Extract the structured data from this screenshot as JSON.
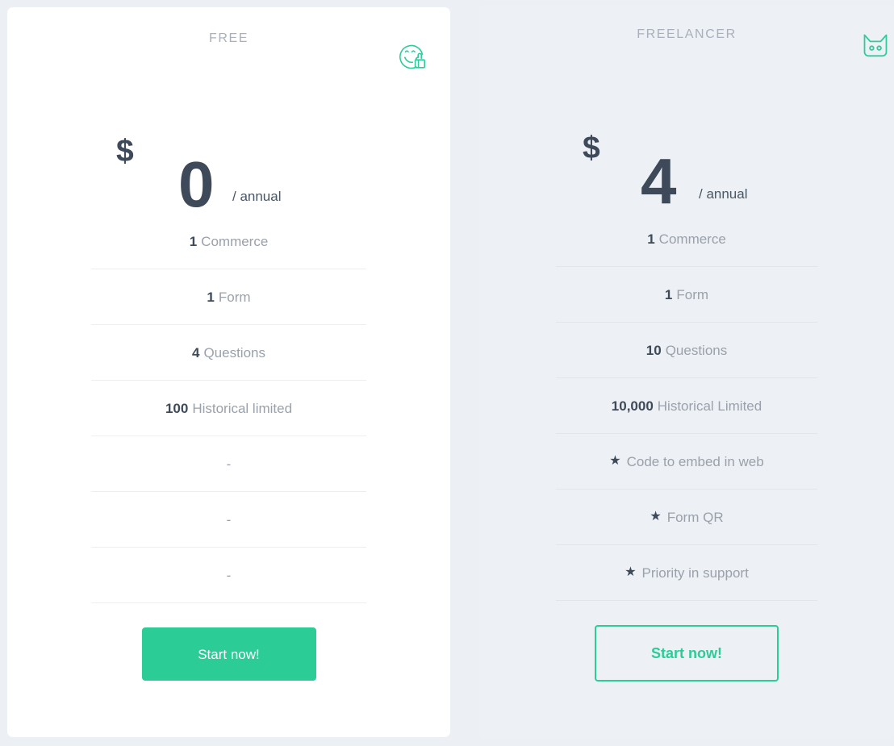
{
  "theme": {
    "page_background": "#eceff4",
    "accent": "#2bcc96",
    "value_text": "#3e4a59",
    "label_text": "#9aa1ab",
    "plan_name_text": "#a9b0bb"
  },
  "plans": [
    {
      "name": "FREE",
      "icon": "smiley-thumbs-up-icon",
      "currency": "$",
      "amount": "0",
      "period": "/ annual",
      "card_background": "#ffffff",
      "features": [
        {
          "value": "1",
          "label": "Commerce",
          "star": false,
          "empty": false
        },
        {
          "value": "1",
          "label": "Form",
          "star": false,
          "empty": false
        },
        {
          "value": "4",
          "label": "Questions",
          "star": false,
          "empty": false
        },
        {
          "value": "100",
          "label": "Historical limited",
          "star": false,
          "empty": false
        },
        {
          "value": "",
          "label": "-",
          "star": false,
          "empty": true
        },
        {
          "value": "",
          "label": "-",
          "star": false,
          "empty": true
        },
        {
          "value": "",
          "label": "-",
          "star": false,
          "empty": true
        }
      ],
      "cta_label": "Start now!",
      "cta_style": "solid"
    },
    {
      "name": "FREELANCER",
      "icon": "cat-mask-icon",
      "currency": "$",
      "amount": "4",
      "period": "/ annual",
      "card_background": "#edf0f5",
      "features": [
        {
          "value": "1",
          "label": "Commerce",
          "star": false,
          "empty": false
        },
        {
          "value": "1",
          "label": "Form",
          "star": false,
          "empty": false
        },
        {
          "value": "10",
          "label": "Questions",
          "star": false,
          "empty": false
        },
        {
          "value": "10,000",
          "label": "Historical Limited",
          "star": false,
          "empty": false
        },
        {
          "value": "",
          "label": "Code to embed in web",
          "star": true,
          "empty": false
        },
        {
          "value": "",
          "label": "Form QR",
          "star": true,
          "empty": false
        },
        {
          "value": "",
          "label": "Priority in support",
          "star": true,
          "empty": false
        }
      ],
      "cta_label": "Start now!",
      "cta_style": "outline"
    }
  ],
  "star_glyph": "★"
}
